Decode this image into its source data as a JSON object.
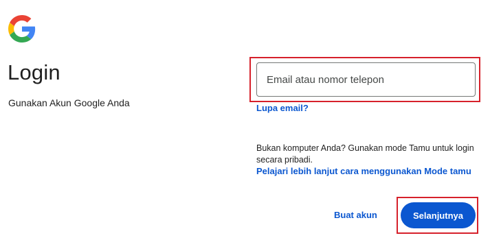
{
  "header": {
    "logo_icon": "google-g-logo",
    "title": "Login",
    "subtitle": "Gunakan Akun Google Anda"
  },
  "form": {
    "email_placeholder": "Email atau nomor telepon",
    "email_value": "",
    "forgot_email_label": "Lupa email?",
    "guest_text": "Bukan komputer Anda? Gunakan mode Tamu untuk login secara pribadi.",
    "guest_link_label": "Pelajari lebih lanjut cara menggunakan Mode tamu"
  },
  "actions": {
    "create_account_label": "Buat akun",
    "next_label": "Selanjutnya"
  },
  "colors": {
    "primary": "#0b57d0",
    "highlight": "#d6202a",
    "text": "#1f1f1f"
  }
}
